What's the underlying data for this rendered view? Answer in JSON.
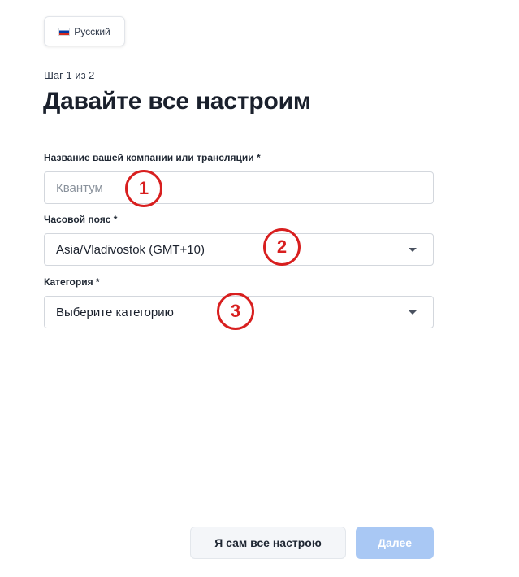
{
  "language_button": {
    "flag_icon": "russia-flag-icon",
    "label": "Русский"
  },
  "step_indicator": "Шаг 1 из 2",
  "page_title": "Давайте все настроим",
  "fields": {
    "company": {
      "label": "Название вашей компании или трансляции *",
      "value": "",
      "placeholder": "Квантум"
    },
    "timezone": {
      "label": "Часовой пояс *",
      "selected": "Asia/Vladivostok (GMT+10)",
      "icon": "chevron-down-icon"
    },
    "category": {
      "label": "Категория *",
      "selected": "Выберите категорию",
      "icon": "chevron-down-icon"
    }
  },
  "annotations": [
    "1",
    "2",
    "3"
  ],
  "buttons": {
    "setup_myself": "Я сам все настрою",
    "next": "Далее"
  },
  "colors": {
    "annotation_red": "#d81f1f",
    "primary_disabled": "#a9c8f4",
    "secondary_bg": "#f4f6f9",
    "title_text": "#1a202c"
  }
}
